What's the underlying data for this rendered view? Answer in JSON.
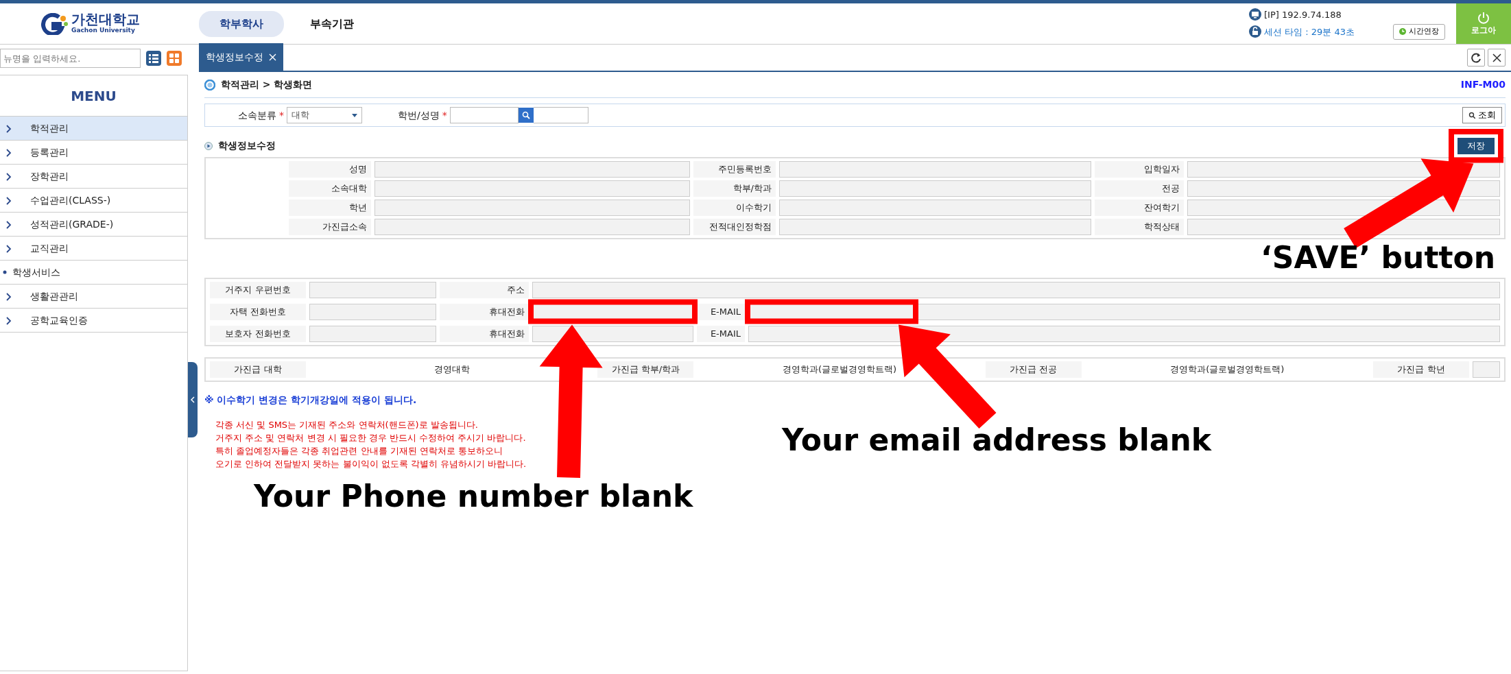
{
  "header": {
    "logo": {
      "name": "가천대학교",
      "subtitle": "Gachon University"
    },
    "tabs": [
      {
        "label": "학부학사",
        "selected": true
      },
      {
        "label": "부속기관",
        "selected": false
      }
    ],
    "ip": "[IP] 192.9.74.188",
    "session": "세션 타임 : 29분 43초",
    "extend_button": "시간연장",
    "logout_button": "로그아"
  },
  "menu_search": {
    "placeholder": "뉴명을 입력하세요."
  },
  "sidebar": {
    "title": "MENU",
    "items": [
      {
        "label": "학적관리",
        "kind": "menu",
        "selected": true
      },
      {
        "label": "등록관리",
        "kind": "menu",
        "selected": false
      },
      {
        "label": "장학관리",
        "kind": "menu",
        "selected": false
      },
      {
        "label": "수업관리(CLASS-)",
        "kind": "menu",
        "selected": false
      },
      {
        "label": "성적관리(GRADE-)",
        "kind": "menu",
        "selected": false
      },
      {
        "label": "교직관리",
        "kind": "menu",
        "selected": false
      },
      {
        "label": "학생서비스",
        "kind": "group",
        "selected": false
      },
      {
        "label": "생활관관리",
        "kind": "menu",
        "selected": false
      },
      {
        "label": "공학교육인증",
        "kind": "menu",
        "selected": false
      }
    ]
  },
  "page_tabs": [
    {
      "label": "학생정보수정",
      "selected": true
    }
  ],
  "breadcrumb": "학적관리 > 학생화면",
  "screen_code": "INF-M00",
  "search": {
    "fields": [
      {
        "label": "소속분류",
        "required_mark": "*",
        "kind": "select",
        "value": "대학"
      },
      {
        "label": "학번/성명",
        "required_mark": "*",
        "kind": "search"
      }
    ],
    "button": "조회"
  },
  "section": {
    "title": "학생정보수정",
    "save_button": {
      "label": "저장",
      "highlighted": true,
      "callout": "‘SAVE’ button"
    }
  },
  "student_info": {
    "rows": [
      [
        "성명",
        "주민등록번호",
        "입학일자"
      ],
      [
        "소속대학",
        "학부/학과",
        "전공"
      ],
      [
        "학년",
        "이수학기",
        "잔여학기"
      ],
      [
        "가진급소속",
        "전적대인정학점",
        "학적상태"
      ]
    ]
  },
  "contact": {
    "rows": [
      {
        "fields": [
          {
            "label": "거주지 우편번호"
          },
          {
            "label": "주소"
          }
        ]
      },
      {
        "fields": [
          {
            "label": "자택 전화번호"
          },
          {
            "label": "휴대전화",
            "highlighted": true,
            "callout": "Your Phone number blank"
          },
          {
            "label": "E-MAIL",
            "highlighted": true,
            "callout": "Your email address blank"
          }
        ]
      },
      {
        "fields": [
          {
            "label": "보호자 전화번호"
          },
          {
            "label": "휴대전화"
          },
          {
            "label": "E-MAIL"
          }
        ]
      }
    ]
  },
  "provisional": {
    "pairs": [
      {
        "label": "가진급 대학",
        "value": "경영대학"
      },
      {
        "label": "가진급 학부/학과",
        "value": "경영학과(글로벌경영학트랙)"
      },
      {
        "label": "가진급 전공",
        "value": "경영학과(글로벌경영학트랙)"
      },
      {
        "label": "가진급 학년"
      }
    ]
  },
  "notice": "※ 이수학기 변경은 학기개강일에 적용이 됩니다.",
  "warnings": [
    "각종 서신 및 SMS는 기재된 주소와 연락처(핸드폰)로 발송됩니다.",
    "거주지 주소 및 연락처 변경 시 필요한 경우 반드시 수정하여 주시기 바랍니다.",
    "특히 졸업예정자들은 각종 취업관련 안내를 기재된 연락처로 통보하오니",
    "오기로 인하여 전달받지 못하는 불이익이 없도록 각별히 유념하시기 바랍니다."
  ]
}
